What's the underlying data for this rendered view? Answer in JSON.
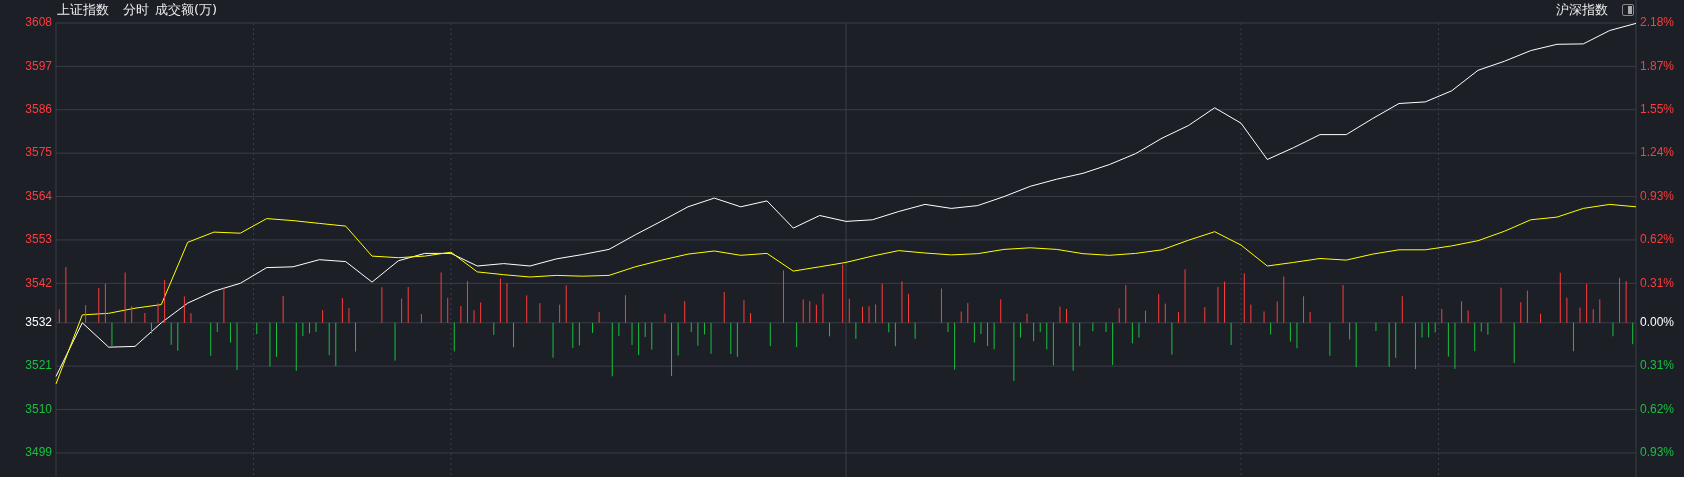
{
  "header": {
    "title": "上证指数",
    "mode": "分时",
    "indicator": "成交额(万)",
    "market": "沪深指数"
  },
  "chart": {
    "chart_data": {
      "type": "line",
      "categories": [
        null,
        null,
        null,
        null,
        null,
        null,
        null,
        null,
        null,
        null,
        null,
        null,
        null,
        null,
        null,
        null,
        null,
        null,
        null,
        null,
        null,
        null,
        null,
        null,
        null,
        null,
        null,
        null,
        null,
        null,
        null,
        null,
        null,
        null,
        null,
        null,
        null,
        null,
        null,
        null,
        null,
        null,
        null,
        null,
        null,
        null,
        null,
        null,
        null,
        null,
        null,
        null,
        null,
        null,
        null,
        null,
        null,
        null,
        null,
        null,
        null
      ],
      "ylim": [
        3492.9,
        3608
      ],
      "grid": true,
      "yticks": [
        {
          "value": 3608,
          "label": "3608"
        },
        {
          "value": 3597,
          "label": "3597"
        },
        {
          "value": 3586,
          "label": "3586"
        },
        {
          "value": 3575,
          "label": "3575"
        },
        {
          "value": 3564,
          "label": "3564"
        },
        {
          "value": 3553,
          "label": "3553"
        },
        {
          "value": 3542,
          "label": "3542"
        },
        {
          "value": 3532,
          "label": "3532"
        },
        {
          "value": 3521,
          "label": "3521"
        },
        {
          "value": 3510,
          "label": "3510"
        },
        {
          "value": 3499,
          "label": "3499"
        }
      ],
      "series": [
        {
          "color": "#ffffff",
          "values": [
            3518.4,
            3532,
            3525.8,
            3526,
            3532,
            3537,
            3540,
            3542,
            3546,
            3546.2,
            3548,
            3547.5,
            3542.3,
            3547.7,
            3549.6,
            3549.6,
            3546.4,
            3547,
            3546.4,
            3548.2,
            3549.3,
            3550.6,
            3554.3,
            3557.8,
            3561.4,
            3563.6,
            3561.4,
            3562.9,
            3556,
            3559.2,
            3557.7,
            3558.1,
            3560.2,
            3562,
            3561,
            3561.7,
            3564,
            3566.6,
            3568.4,
            3569.9,
            3572.1,
            3574.9,
            3578.8,
            3582,
            3586.5,
            3582.6,
            3573.4,
            3576.4,
            3579.7,
            3579.7,
            3583.8,
            3587.6,
            3588,
            3590.8,
            3596,
            3598.3,
            3601,
            3602.6,
            3602.7,
            3606.1,
            3607.9
          ]
        },
        {
          "color": "#ffff00",
          "values": [
            3516.5,
            3534,
            3534.4,
            3535.7,
            3536.6,
            3552.4,
            3555,
            3554.7,
            3558.4,
            3557.9,
            3557.2,
            3556.5,
            3548.9,
            3548.5,
            3548.9,
            3549.9,
            3544.9,
            3544.2,
            3543.6,
            3544,
            3543.8,
            3544,
            3546.2,
            3547.9,
            3549.4,
            3550.2,
            3549.1,
            3549.6,
            3545.1,
            3546.2,
            3547.3,
            3548.9,
            3550.3,
            3549.7,
            3549.2,
            3549.5,
            3550.6,
            3551,
            3550.6,
            3549.5,
            3549.1,
            3549.6,
            3550.5,
            3552.9,
            3555.1,
            3551.7,
            3546.4,
            3547.3,
            3548.3,
            3547.9,
            3549.4,
            3550.5,
            3550.5,
            3551.5,
            3552.8,
            3555.2,
            3558.1,
            3558.8,
            3561,
            3562,
            3561.4
          ]
        }
      ]
    },
    "right_axis": [
      {
        "label": "2.18%",
        "color": "#ff3c3c"
      },
      {
        "label": "1.87%",
        "color": "#ff3c3c"
      },
      {
        "label": "1.55%",
        "color": "#ff3c3c"
      },
      {
        "label": "1.24%",
        "color": "#ff3c3c"
      },
      {
        "label": "0.93%",
        "color": "#ff3c3c"
      },
      {
        "label": "0.62%",
        "color": "#ff3c3c"
      },
      {
        "label": "0.31%",
        "color": "#ff3c3c"
      },
      {
        "label": "0.00%",
        "color": "#ffffff"
      },
      {
        "label": "0.31%",
        "color": "#18c040"
      },
      {
        "label": "0.62%",
        "color": "#18c040"
      },
      {
        "label": "0.93%",
        "color": "#18c040"
      }
    ]
  }
}
